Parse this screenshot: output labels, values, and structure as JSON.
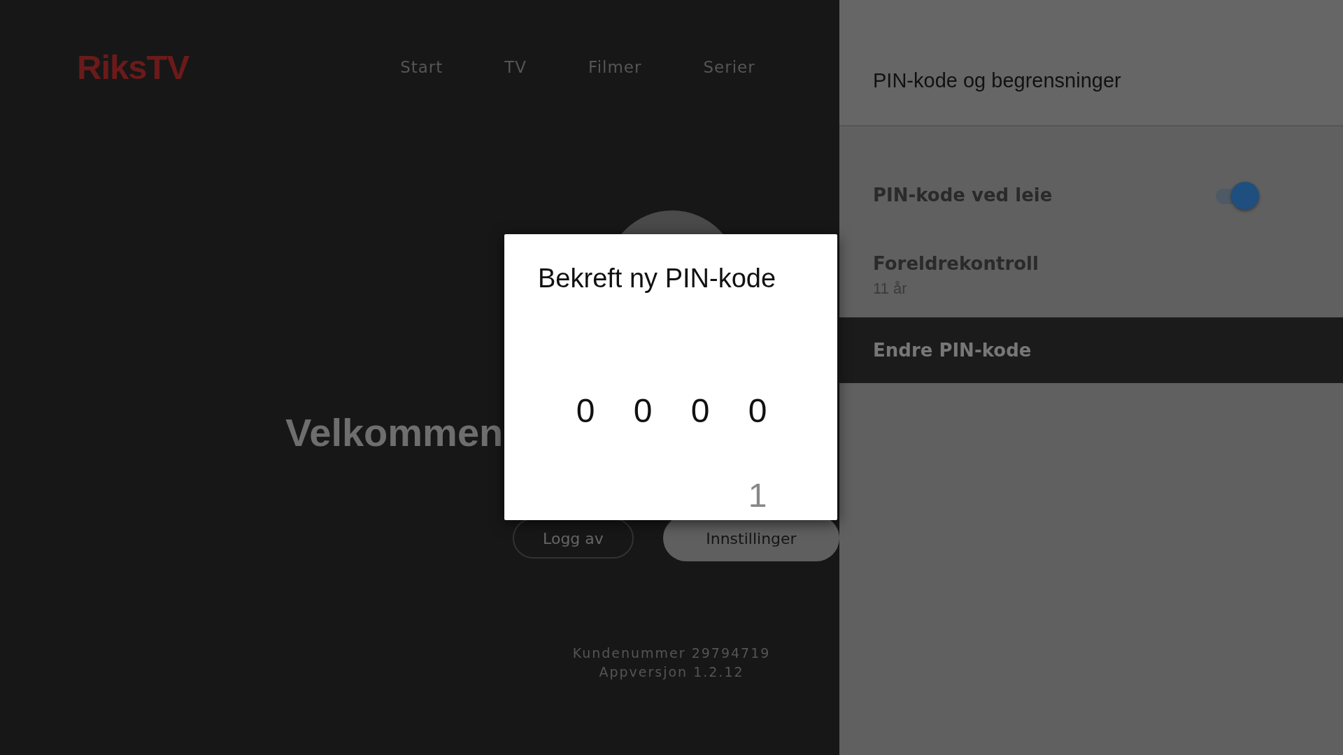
{
  "logo": "RiksTV",
  "nav": [
    {
      "label": "Start"
    },
    {
      "label": "TV"
    },
    {
      "label": "Filmer"
    },
    {
      "label": "Serier"
    }
  ],
  "welcome": "Velkommen",
  "buttons": [
    {
      "label": "Logg av",
      "kind": "outline"
    },
    {
      "label": "Innstillinger",
      "kind": "filled"
    }
  ],
  "footer": [
    "Kundenummer 29794719",
    "Appversjon 1.2.12"
  ],
  "panel": {
    "title": "PIN-kode og begrensninger",
    "items": [
      {
        "kind": "toggle",
        "label": "PIN-kode ved leie",
        "on": true,
        "selected": false
      },
      {
        "kind": "value",
        "label": "Foreldrekontroll",
        "value": "11 år",
        "selected": false
      },
      {
        "kind": "action",
        "label": "Endre PIN-kode",
        "selected": true
      }
    ]
  },
  "dialog": {
    "title": "Bekreft ny PIN-kode",
    "digits": [
      {
        "value": "0"
      },
      {
        "value": "0"
      },
      {
        "value": "0"
      },
      {
        "value": "0",
        "next": "1"
      }
    ]
  }
}
